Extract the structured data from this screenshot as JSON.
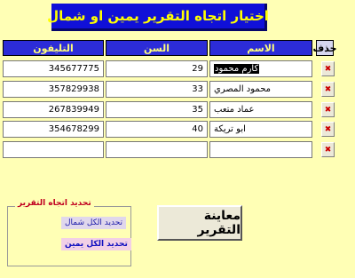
{
  "title": "اختيار اتجاه التقرير يمين او شمال",
  "table": {
    "headers": {
      "name": "الاسم",
      "age": "السن",
      "phone": "التليفون",
      "delete": "حذف"
    },
    "rows": [
      {
        "name": "كارم محمود",
        "age": "29",
        "phone": "345677775"
      },
      {
        "name": "محمود المصري",
        "age": "33",
        "phone": "357829938"
      },
      {
        "name": "عماد متعب",
        "age": "35",
        "phone": "267839949"
      },
      {
        "name": "ابو تريكة",
        "age": "40",
        "phone": "354678299"
      },
      {
        "name": "",
        "age": "",
        "phone": ""
      }
    ],
    "delete_icon": "delete-x-icon",
    "delete_glyph": "✖"
  },
  "direction_group": {
    "title": "تحديد اتجاه التقرير",
    "option_left": {
      "label": "تحديد الكل شمال",
      "checked": true,
      "mark": "✓"
    },
    "option_right": {
      "label": "تحديد الكل يمين",
      "checked": false,
      "mark": ""
    }
  },
  "preview_button": "معاينة التقرير",
  "colors": {
    "background": "#ffffb5",
    "title_bg": "#1010d8",
    "title_text": "#ffff00",
    "header_bg": "#2c2cd8",
    "header_text": "#ffff7a"
  }
}
